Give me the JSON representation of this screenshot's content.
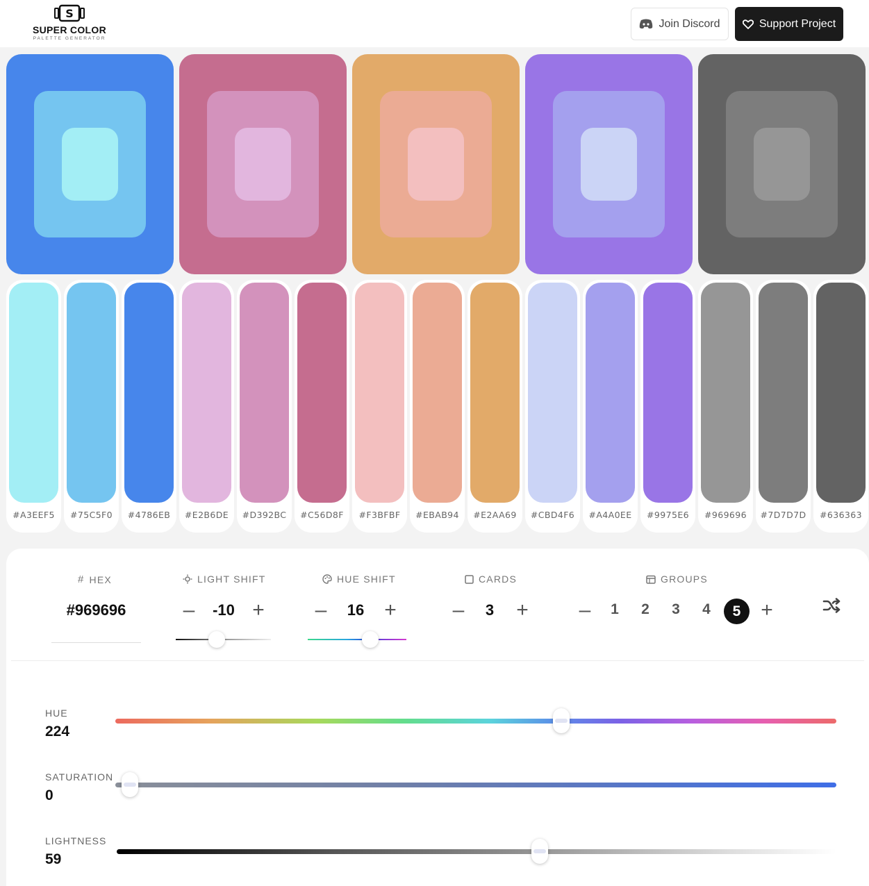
{
  "brand": {
    "name": "SUPER COLOR",
    "tagline": "PALETTE GENERATOR",
    "logo_letter": "S"
  },
  "header": {
    "discord_label": "Join Discord",
    "support_label": "Support Project"
  },
  "cards": [
    {
      "outer": "#4786EB",
      "mid": "#75C5F0",
      "inner": "#A3EEF5"
    },
    {
      "outer": "#C56D8F",
      "mid": "#D392BC",
      "inner": "#E2B6DE"
    },
    {
      "outer": "#E2AA69",
      "mid": "#EBAB94",
      "inner": "#F3BFBF"
    },
    {
      "outer": "#9975E6",
      "mid": "#A4A0EE",
      "inner": "#CBD4F6"
    },
    {
      "outer": "#636363",
      "mid": "#7D7D7D",
      "inner": "#969696"
    }
  ],
  "swatches": [
    {
      "hex": "#A3EEF5"
    },
    {
      "hex": "#75C5F0"
    },
    {
      "hex": "#4786EB"
    },
    {
      "hex": "#E2B6DE"
    },
    {
      "hex": "#D392BC"
    },
    {
      "hex": "#C56D8F"
    },
    {
      "hex": "#F3BFBF"
    },
    {
      "hex": "#EBAB94"
    },
    {
      "hex": "#E2AA69"
    },
    {
      "hex": "#CBD4F6"
    },
    {
      "hex": "#A4A0EE"
    },
    {
      "hex": "#9975E6"
    },
    {
      "hex": "#969696"
    },
    {
      "hex": "#7D7D7D"
    },
    {
      "hex": "#636363"
    }
  ],
  "controls": {
    "hex": {
      "label": "HEX",
      "value": "#969696"
    },
    "light_shift": {
      "label": "LIGHT SHIFT",
      "value": "-10"
    },
    "hue_shift": {
      "label": "HUE SHIFT",
      "value": "16"
    },
    "cards": {
      "label": "CARDS",
      "value": "3"
    },
    "groups": {
      "label": "GROUPS",
      "options": [
        "1",
        "2",
        "3",
        "4",
        "5"
      ],
      "selected": "5"
    },
    "minus": "–",
    "plus": "+"
  },
  "hsl": {
    "hue": {
      "label": "HUE",
      "value": "224"
    },
    "saturation": {
      "label": "SATURATION",
      "value": "0"
    },
    "lightness": {
      "label": "LIGHTNESS",
      "value": "59"
    }
  }
}
